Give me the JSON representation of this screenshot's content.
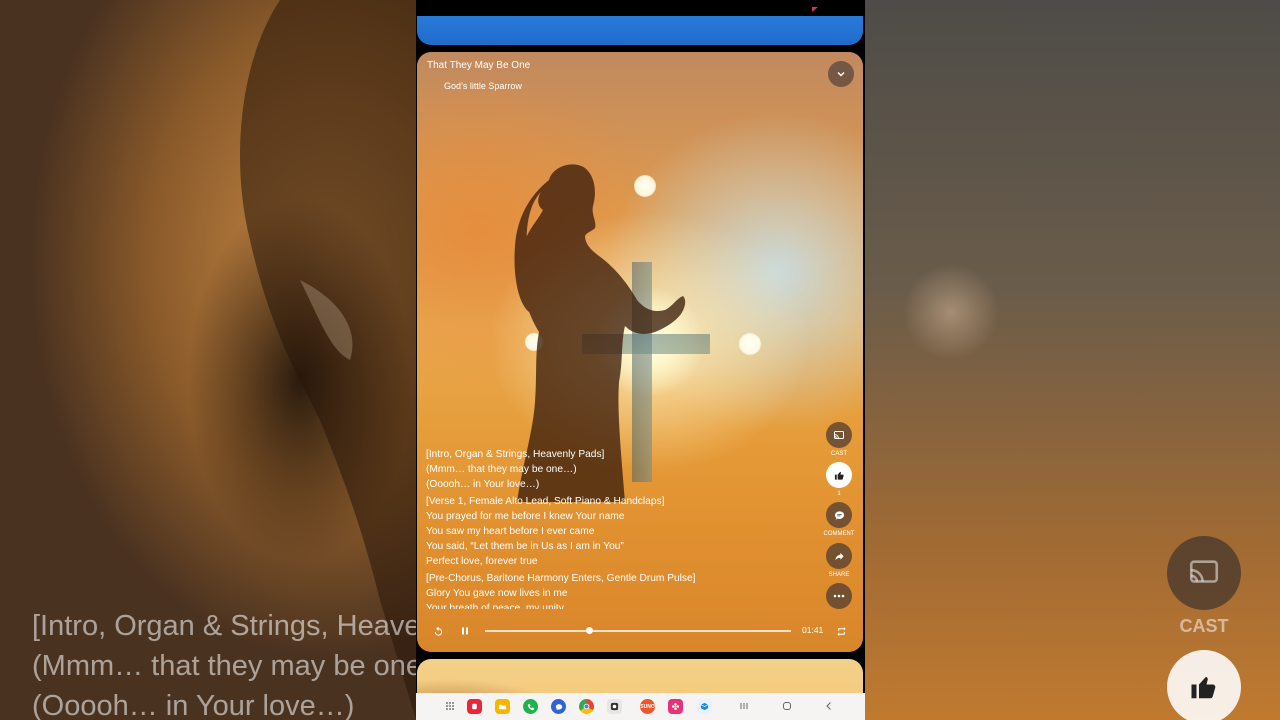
{
  "song": {
    "title": "That They May Be One",
    "artist": "God’s little Sparrow"
  },
  "lyrics": [
    [
      "[Intro, Organ & Strings, Heavenly Pads]",
      "(Mmm… that they may be one…)",
      "(Ooooh… in Your love…)"
    ],
    [
      "[Verse 1, Female Alto Lead, Soft Piano & Handclaps]",
      "You prayed for me before I knew Your name",
      "You saw my heart before I ever came",
      "You said, “Let them be in Us as I am in You”",
      "Perfect love, forever true"
    ],
    [
      "[Pre-Chorus, Baritone Harmony Enters, Gentle Drum Pulse]",
      "Glory You gave now lives in me",
      "Your breath of peace, my unity"
    ]
  ],
  "background_lyrics": [
    "[Intro, Organ & Strings, Heavenly Pads]",
    "(Mmm… that they may be one…)",
    "(Ooooh… in Your love…)"
  ],
  "actions": {
    "cast_label": "CAST",
    "like_count": "1",
    "comment_label": "COMMENT",
    "share_label": "SHARE"
  },
  "background_actions": {
    "cast_label": "CAST"
  },
  "playback": {
    "time": "01:41",
    "progress": 0.34,
    "state": "playing"
  },
  "taskbar": {
    "apps": [
      {
        "name": "apps-grid-icon"
      },
      {
        "name": "red-app-icon",
        "color": "#e8283a"
      },
      {
        "name": "files-app-icon",
        "color": "#f7b500"
      },
      {
        "name": "phone-app-icon",
        "color": "#22b24c"
      },
      {
        "name": "messages-app-icon",
        "color": "#2f62d6"
      },
      {
        "name": "chrome-app-icon"
      },
      {
        "name": "camera-app-icon",
        "color": "#333333"
      },
      {
        "name": "suno-app-icon",
        "color": "#f0552a",
        "label": "SUNO"
      },
      {
        "name": "flower-app-icon",
        "color": "#e8317a"
      },
      {
        "name": "box-app-icon",
        "color": "#1e88e5"
      }
    ]
  },
  "colors": {
    "accent_blue": "#1f6ccc",
    "player_warm": "#e59b38"
  }
}
